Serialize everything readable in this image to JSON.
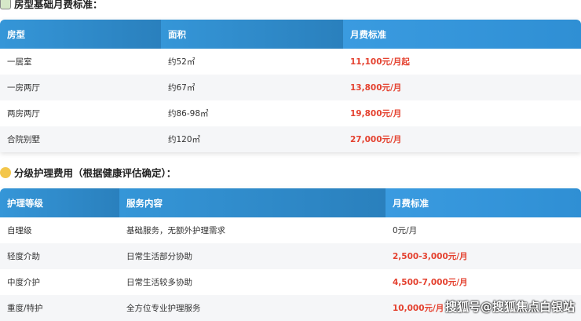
{
  "section1": {
    "title": "房型基础月费标准：",
    "headers": [
      "房型",
      "面积",
      "月费标准"
    ],
    "rows": [
      [
        "一居室",
        "约52㎡",
        "11,100元/月起"
      ],
      [
        "一房两厅",
        "约67㎡",
        "13,800元/月"
      ],
      [
        "两房两厅",
        "约86-98㎡",
        "19,800元/月"
      ],
      [
        "合院别墅",
        "约120㎡",
        "27,000元/月"
      ]
    ]
  },
  "section2": {
    "title": "分级护理费用（根据健康评估确定）：",
    "headers": [
      "护理等级",
      "服务内容",
      "月费标准"
    ],
    "rows": [
      [
        "自理级",
        "基础服务，无额外护理需求",
        "0元/月"
      ],
      [
        "轻度介助",
        "日常生活部分协助",
        "2,500-3,000元/月"
      ],
      [
        "中度介护",
        "日常生活较多协助",
        "4,500-7,000元/月"
      ],
      [
        "重度/特护",
        "全方位专业护理服务",
        "10,000元/月"
      ]
    ]
  },
  "watermark": "搜狐号@搜狐焦点白银站",
  "colors": {
    "header": "#2e8dd0",
    "price": "#e4412f"
  }
}
